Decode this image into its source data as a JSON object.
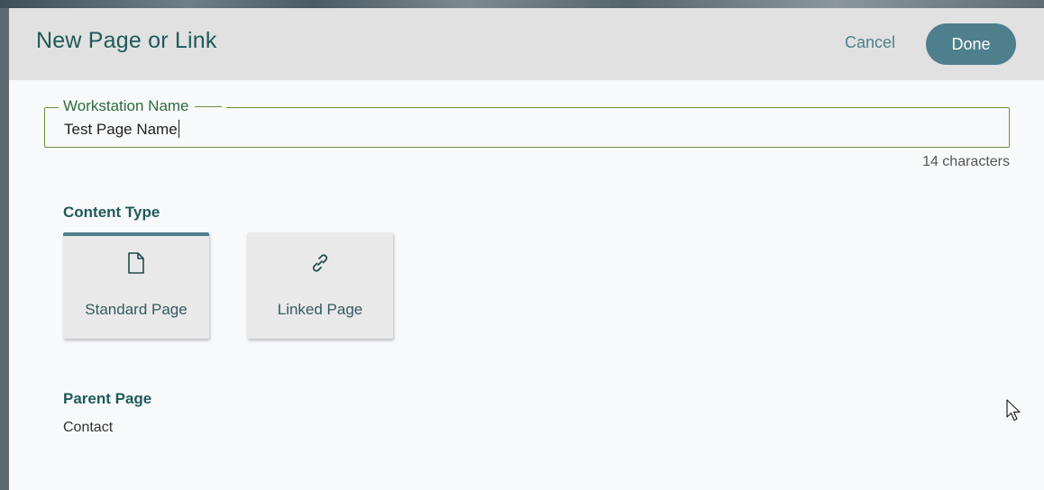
{
  "dialog": {
    "title": "New Page or Link",
    "cancel_label": "Cancel",
    "done_label": "Done"
  },
  "workstation_name": {
    "label": "Workstation Name",
    "value": "Test Page Name",
    "char_count": "14 characters"
  },
  "content_type": {
    "label": "Content Type",
    "options": [
      {
        "label": "Standard Page",
        "icon": "document-icon",
        "selected": true
      },
      {
        "label": "Linked Page",
        "icon": "link-icon",
        "selected": false
      }
    ]
  },
  "parent_page": {
    "label": "Parent Page",
    "value": "Contact"
  },
  "colors": {
    "accent": "#4f7f8c",
    "title": "#1f5a5a",
    "field_border": "#6b8f3a",
    "header_bg": "#e1e1e1"
  }
}
